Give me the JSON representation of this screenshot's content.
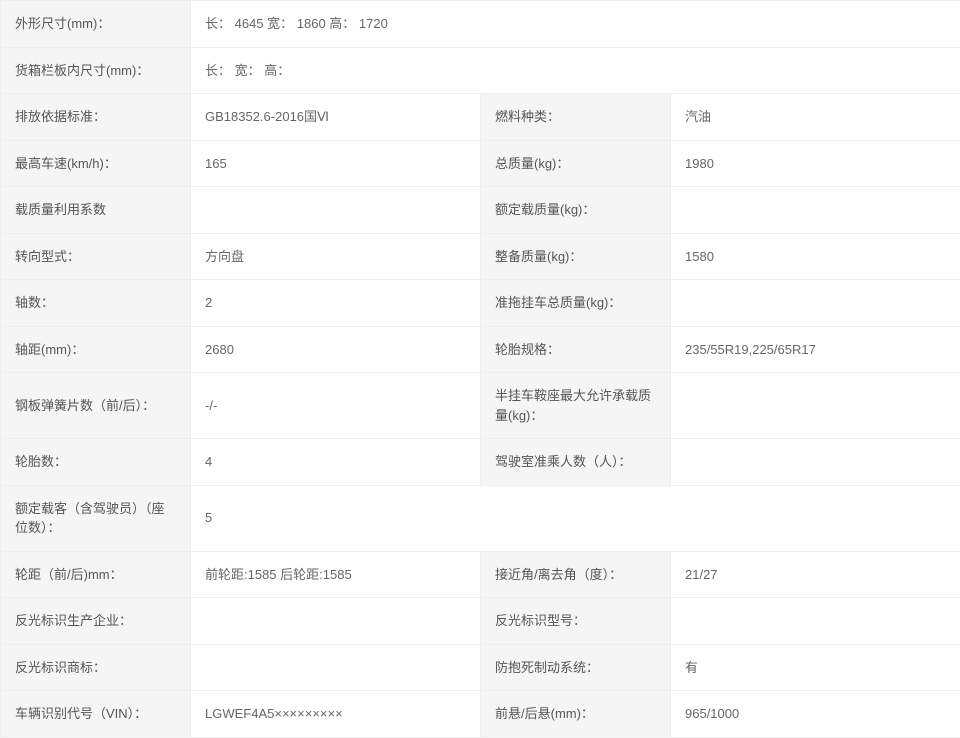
{
  "specs": {
    "dimensions_label": "外形尺寸(mm)：",
    "dimensions_value": "长： 4645 宽： 1860 高： 1720",
    "cargo_dim_label": "货箱栏板内尺寸(mm)：",
    "cargo_dim_value": "长： 宽： 高：",
    "emission_std_label": "排放依据标准：",
    "emission_std_value": "GB18352.6-2016国Ⅵ",
    "fuel_type_label": "燃料种类：",
    "fuel_type_value": "汽油",
    "max_speed_label": "最高车速(km/h)：",
    "max_speed_value": "165",
    "gross_mass_label": "总质量(kg)：",
    "gross_mass_value": "1980",
    "load_coef_label": "载质量利用系数",
    "load_coef_value": "",
    "rated_load_label": "额定载质量(kg)：",
    "rated_load_value": "",
    "steering_label": "转向型式：",
    "steering_value": "方向盘",
    "curb_mass_label": "整备质量(kg)：",
    "curb_mass_value": "1580",
    "axles_label": "轴数：",
    "axles_value": "2",
    "trailer_mass_label": "准拖挂车总质量(kg)：",
    "trailer_mass_value": "",
    "wheelbase_label": "轴距(mm)：",
    "wheelbase_value": "2680",
    "tire_spec_label": "轮胎规格：",
    "tire_spec_value": "235/55R19,225/65R17",
    "leaf_spring_label": "钢板弹簧片数（前/后）：",
    "leaf_spring_value": "-/-",
    "saddle_load_label": "半挂车鞍座最大允许承载质量(kg)：",
    "saddle_load_value": "",
    "tire_count_label": "轮胎数：",
    "tire_count_value": "4",
    "cab_seats_label": "驾驶室准乘人数（人）：",
    "cab_seats_value": "",
    "rated_pax_label": "额定载客（含驾驶员）（座位数）：",
    "rated_pax_value": "5",
    "track_label": "轮距（前/后)mm：",
    "track_value": "前轮距:1585 后轮距:1585",
    "angles_label": "接近角/离去角（度）：",
    "angles_value": "21/27",
    "refl_mfr_label": "反光标识生产企业：",
    "refl_mfr_value": "",
    "refl_model_label": "反光标识型号：",
    "refl_model_value": "",
    "refl_brand_label": "反光标识商标：",
    "refl_brand_value": "",
    "abs_label": "防抱死制动系统：",
    "abs_value": "有",
    "vin_label": "车辆识别代号（VIN）：",
    "vin_value": "LGWEF4A5×××××××××",
    "overhang_label": "前悬/后悬(mm)：",
    "overhang_value": "965/1000"
  }
}
